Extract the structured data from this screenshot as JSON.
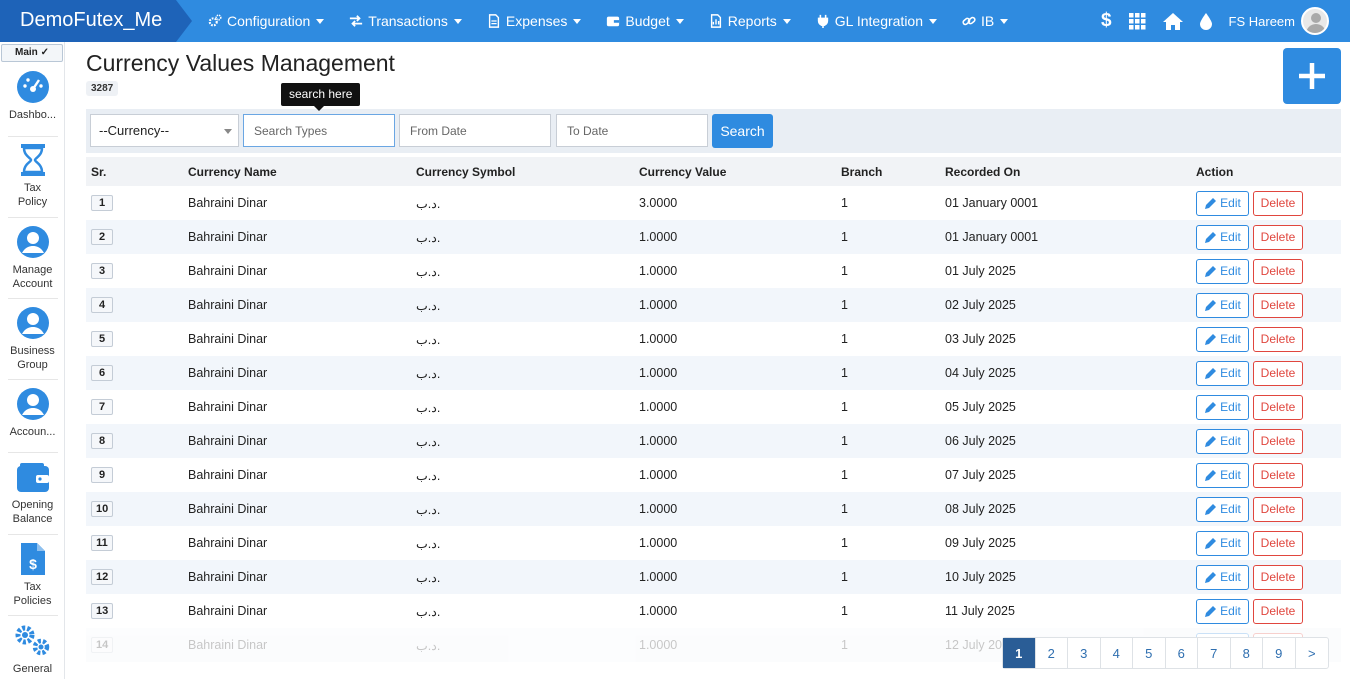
{
  "app": {
    "brand": "DemoFutex_Me",
    "user_name": "FS Hareem"
  },
  "nav": [
    {
      "label": "Configuration",
      "icon": "gears-icon"
    },
    {
      "label": "Transactions",
      "icon": "exchange-icon"
    },
    {
      "label": "Expenses",
      "icon": "file-icon"
    },
    {
      "label": "Budget",
      "icon": "wallet-icon"
    },
    {
      "label": "Reports",
      "icon": "report-icon"
    },
    {
      "label": "GL Integration",
      "icon": "plug-icon"
    },
    {
      "label": "IB",
      "icon": "link-icon"
    }
  ],
  "sidebar": {
    "main_label": "Main",
    "items": [
      {
        "label": "Dashbo...",
        "icon": "dashboard-icon"
      },
      {
        "label": "Tax Policy",
        "icon": "hourglass-icon"
      },
      {
        "label": "Manage Account",
        "icon": "user-circle-icon"
      },
      {
        "label": "Business Group",
        "icon": "user-circle-icon"
      },
      {
        "label": "Accoun...",
        "icon": "user-circle-icon"
      },
      {
        "label": "Opening Balance",
        "icon": "wallet-icon"
      },
      {
        "label": "Tax Policies",
        "icon": "dollar-file-icon"
      },
      {
        "label": "General",
        "icon": "gears-icon"
      }
    ]
  },
  "page": {
    "title": "Currency Values Management",
    "count": "3287"
  },
  "tooltip": "search here",
  "filters": {
    "currency_select": "--Currency--",
    "search_placeholder": "Search Types",
    "from_date_placeholder": "From Date",
    "to_date_placeholder": "To Date",
    "search_button": "Search"
  },
  "table": {
    "headers": [
      "Sr.",
      "Currency Name",
      "Currency Symbol",
      "Currency Value",
      "Branch",
      "Recorded On",
      "Action"
    ],
    "edit_label": "Edit",
    "delete_label": "Delete",
    "rows": [
      {
        "sr": "1",
        "name": "Bahraini Dinar",
        "symbol": "د.ب.",
        "value": "3.0000",
        "branch": "1",
        "recorded": "01 January 0001"
      },
      {
        "sr": "2",
        "name": "Bahraini Dinar",
        "symbol": "د.ب.",
        "value": "1.0000",
        "branch": "1",
        "recorded": "01 January 0001"
      },
      {
        "sr": "3",
        "name": "Bahraini Dinar",
        "symbol": "د.ب.",
        "value": "1.0000",
        "branch": "1",
        "recorded": "01 July 2025"
      },
      {
        "sr": "4",
        "name": "Bahraini Dinar",
        "symbol": "د.ب.",
        "value": "1.0000",
        "branch": "1",
        "recorded": "02 July 2025"
      },
      {
        "sr": "5",
        "name": "Bahraini Dinar",
        "symbol": "د.ب.",
        "value": "1.0000",
        "branch": "1",
        "recorded": "03 July 2025"
      },
      {
        "sr": "6",
        "name": "Bahraini Dinar",
        "symbol": "د.ب.",
        "value": "1.0000",
        "branch": "1",
        "recorded": "04 July 2025"
      },
      {
        "sr": "7",
        "name": "Bahraini Dinar",
        "symbol": "د.ب.",
        "value": "1.0000",
        "branch": "1",
        "recorded": "05 July 2025"
      },
      {
        "sr": "8",
        "name": "Bahraini Dinar",
        "symbol": "د.ب.",
        "value": "1.0000",
        "branch": "1",
        "recorded": "06 July 2025"
      },
      {
        "sr": "9",
        "name": "Bahraini Dinar",
        "symbol": "د.ب.",
        "value": "1.0000",
        "branch": "1",
        "recorded": "07 July 2025"
      },
      {
        "sr": "10",
        "name": "Bahraini Dinar",
        "symbol": "د.ب.",
        "value": "1.0000",
        "branch": "1",
        "recorded": "08 July 2025"
      },
      {
        "sr": "11",
        "name": "Bahraini Dinar",
        "symbol": "د.ب.",
        "value": "1.0000",
        "branch": "1",
        "recorded": "09 July 2025"
      },
      {
        "sr": "12",
        "name": "Bahraini Dinar",
        "symbol": "د.ب.",
        "value": "1.0000",
        "branch": "1",
        "recorded": "10 July 2025"
      },
      {
        "sr": "13",
        "name": "Bahraini Dinar",
        "symbol": "د.ب.",
        "value": "1.0000",
        "branch": "1",
        "recorded": "11 July 2025"
      },
      {
        "sr": "14",
        "name": "Bahraini Dinar",
        "symbol": "د.ب.",
        "value": "1.0000",
        "branch": "1",
        "recorded": "12 July 2025"
      }
    ]
  },
  "pagination": {
    "pages": [
      "1",
      "2",
      "3",
      "4",
      "5",
      "6",
      "7",
      "8",
      "9"
    ],
    "next": ">",
    "active": "1"
  },
  "colors": {
    "primary": "#2f8be0",
    "brand_dark": "#1e63b8",
    "danger": "#e0463e",
    "pager_active": "#2a5d96"
  }
}
